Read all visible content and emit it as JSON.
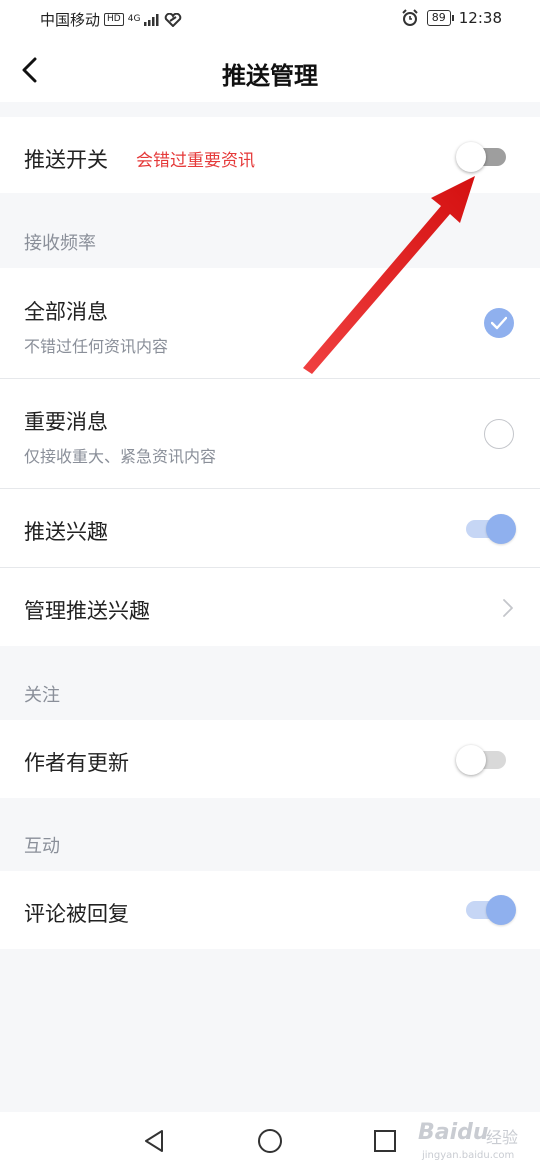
{
  "status_bar": {
    "carrier": "中国移动",
    "hd": "HD",
    "network": "4G",
    "battery": "89",
    "time": "12:38"
  },
  "header": {
    "title": "推送管理"
  },
  "push_switch": {
    "label": "推送开关",
    "warning": "会错过重要资讯",
    "enabled": false
  },
  "frequency": {
    "section_title": "接收频率",
    "options": [
      {
        "label": "全部消息",
        "sub": "不错过任何资讯内容",
        "selected": true
      },
      {
        "label": "重要消息",
        "sub": "仅接收重大、紧急资讯内容",
        "selected": false
      }
    ]
  },
  "interest": {
    "toggle_label": "推送兴趣",
    "toggle_on": true,
    "manage_label": "管理推送兴趣"
  },
  "follow": {
    "section_title": "关注",
    "items": [
      {
        "label": "作者有更新",
        "on": false
      }
    ]
  },
  "interaction": {
    "section_title": "互动",
    "items": [
      {
        "label": "评论被回复",
        "on": true
      }
    ]
  },
  "watermark": {
    "brand": "Baidu",
    "brand_cn": "经验",
    "url": "jingyan.baidu.com"
  },
  "colors": {
    "accent": "#8fb0ee",
    "warning": "#e53a3a",
    "arrow": "#e31b1b"
  }
}
